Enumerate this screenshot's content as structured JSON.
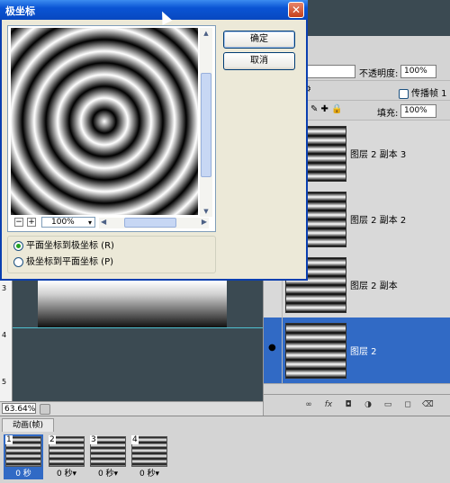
{
  "dialog": {
    "title": "极坐标",
    "close_glyph": "✕",
    "ok_label": "确定",
    "cancel_label": "取消",
    "zoom_value": "100%",
    "zoom_out_glyph": "−",
    "zoom_in_glyph": "+",
    "options": [
      {
        "label": "平面坐标到极坐标 (R)",
        "checked": true
      },
      {
        "label": "极坐标到平面坐标 (P)",
        "checked": false
      }
    ]
  },
  "layers_panel": {
    "opacity_label": "不透明度:",
    "opacity_value": "100%",
    "fill_label": "填充:",
    "fill_value": "100%",
    "propagate_label": "传播帧 1",
    "layers": [
      {
        "name": "图层 2 副本 3",
        "selected": false
      },
      {
        "name": "图层 2 副本 2",
        "selected": false
      },
      {
        "name": "图层 2 副本",
        "selected": false
      },
      {
        "name": "图层 2",
        "selected": true
      }
    ]
  },
  "status_bar": {
    "zoom": "63.64%"
  },
  "rulers": {
    "marks": [
      "3",
      "4",
      "5"
    ]
  },
  "animation": {
    "tab_label": "动画(帧)",
    "frames": [
      {
        "number": "1",
        "time": "0 秒",
        "selected": true
      },
      {
        "number": "2",
        "time": "0 秒▾",
        "selected": false
      },
      {
        "number": "3",
        "time": "0 秒▾",
        "selected": false
      },
      {
        "number": "4",
        "time": "0 秒▾",
        "selected": false
      }
    ]
  },
  "icons": {
    "layer_bottom": [
      "link-icon",
      "fx-icon",
      "mask-icon",
      "adjustment-icon",
      "folder-icon",
      "new-layer-icon",
      "trash-icon"
    ]
  }
}
